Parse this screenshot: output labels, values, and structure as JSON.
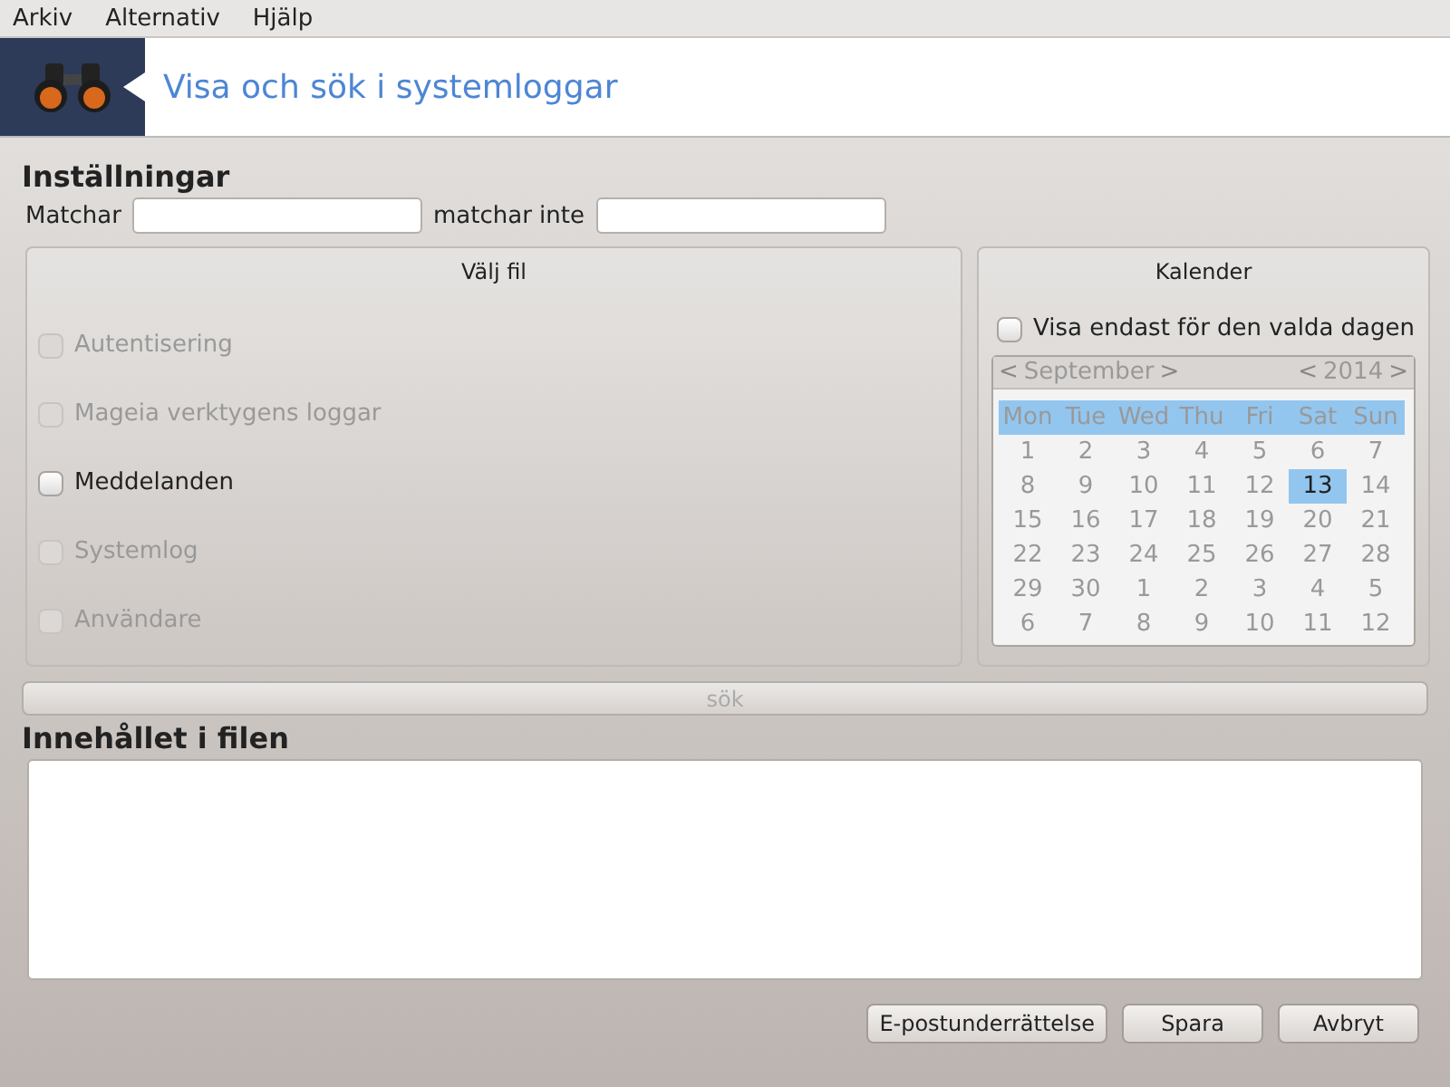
{
  "menu": [
    "Arkiv",
    "Alternativ",
    "Hjälp"
  ],
  "header": {
    "title": "Visa och sök i systemloggar"
  },
  "settings": {
    "heading": "Inställningar",
    "match_label": "Matchar",
    "nomatch_label": "matchar inte"
  },
  "files": {
    "title": "Välj fil",
    "items": [
      {
        "label": "Autentisering",
        "checked": false,
        "disabled": true
      },
      {
        "label": "Mageia verktygens loggar",
        "checked": false,
        "disabled": true
      },
      {
        "label": "Meddelanden",
        "checked": false,
        "disabled": false
      },
      {
        "label": "Systemlog",
        "checked": false,
        "disabled": true
      },
      {
        "label": "Användare",
        "checked": false,
        "disabled": true
      }
    ]
  },
  "calendar": {
    "title": "Kalender",
    "only_day": {
      "label": "Visa endast för den valda dagen",
      "checked": false
    },
    "prev_month": "<",
    "month": "September",
    "next_month": ">",
    "prev_year": "<",
    "year": "2014",
    "next_year": ">",
    "weekdays": [
      "Mon",
      "Tue",
      "Wed",
      "Thu",
      "Fri",
      "Sat",
      "Sun"
    ],
    "days": [
      {
        "label": "1",
        "selected": false
      },
      {
        "label": "2",
        "selected": false
      },
      {
        "label": "3",
        "selected": false
      },
      {
        "label": "4",
        "selected": false
      },
      {
        "label": "5",
        "selected": false
      },
      {
        "label": "6",
        "selected": false
      },
      {
        "label": "7",
        "selected": false
      },
      {
        "label": "8",
        "selected": false
      },
      {
        "label": "9",
        "selected": false
      },
      {
        "label": "10",
        "selected": false
      },
      {
        "label": "11",
        "selected": false
      },
      {
        "label": "12",
        "selected": false
      },
      {
        "label": "13",
        "selected": true
      },
      {
        "label": "14",
        "selected": false
      },
      {
        "label": "15",
        "selected": false
      },
      {
        "label": "16",
        "selected": false
      },
      {
        "label": "17",
        "selected": false
      },
      {
        "label": "18",
        "selected": false
      },
      {
        "label": "19",
        "selected": false
      },
      {
        "label": "20",
        "selected": false
      },
      {
        "label": "21",
        "selected": false
      },
      {
        "label": "22",
        "selected": false
      },
      {
        "label": "23",
        "selected": false
      },
      {
        "label": "24",
        "selected": false
      },
      {
        "label": "25",
        "selected": false
      },
      {
        "label": "26",
        "selected": false
      },
      {
        "label": "27",
        "selected": false
      },
      {
        "label": "28",
        "selected": false
      },
      {
        "label": "29",
        "selected": false
      },
      {
        "label": "30",
        "selected": false
      },
      {
        "label": "1",
        "selected": false
      },
      {
        "label": "2",
        "selected": false
      },
      {
        "label": "3",
        "selected": false
      },
      {
        "label": "4",
        "selected": false
      },
      {
        "label": "5",
        "selected": false
      },
      {
        "label": "6",
        "selected": false
      },
      {
        "label": "7",
        "selected": false
      },
      {
        "label": "8",
        "selected": false
      },
      {
        "label": "9",
        "selected": false
      },
      {
        "label": "10",
        "selected": false
      },
      {
        "label": "11",
        "selected": false
      },
      {
        "label": "12",
        "selected": false
      }
    ]
  },
  "search_button": {
    "label": "sök",
    "disabled": true
  },
  "content": {
    "heading": "Innehållet i filen"
  },
  "buttons": [
    "E-postunderrättelse",
    "Spara",
    "Avbryt"
  ]
}
